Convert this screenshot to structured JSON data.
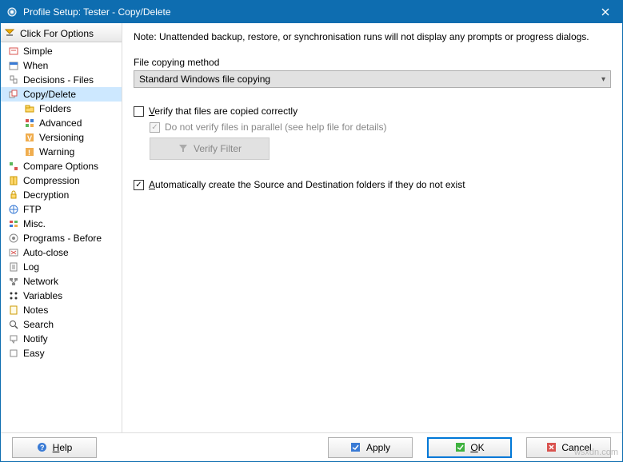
{
  "titlebar": {
    "title": "Profile Setup: Tester - Copy/Delete"
  },
  "sidebar": {
    "options_header": "Click For Options",
    "items": [
      {
        "label": "Simple"
      },
      {
        "label": "When"
      },
      {
        "label": "Decisions - Files"
      },
      {
        "label": "Copy/Delete",
        "selected": true
      },
      {
        "label": "Folders",
        "child": true
      },
      {
        "label": "Advanced",
        "child": true
      },
      {
        "label": "Versioning",
        "child": true
      },
      {
        "label": "Warning",
        "child": true
      },
      {
        "label": "Compare Options"
      },
      {
        "label": "Compression"
      },
      {
        "label": "Decryption"
      },
      {
        "label": "FTP"
      },
      {
        "label": "Misc."
      },
      {
        "label": "Programs - Before"
      },
      {
        "label": "Auto-close"
      },
      {
        "label": "Log"
      },
      {
        "label": "Network"
      },
      {
        "label": "Variables"
      },
      {
        "label": "Notes"
      },
      {
        "label": "Search"
      },
      {
        "label": "Notify"
      },
      {
        "label": "Easy"
      }
    ]
  },
  "main": {
    "note": "Note: Unattended backup, restore, or synchronisation runs will not display any prompts or progress dialogs.",
    "copy_method_label": "File copying method",
    "copy_method_value": "Standard Windows file copying",
    "verify_label": "Verify that files are copied correctly",
    "verify_checked": false,
    "parallel_label": "Do not verify files in parallel (see help file for details)",
    "parallel_checked": true,
    "verify_filter_btn": "Verify Filter",
    "autocreate_label": "Automatically create the Source and Destination folders if they do not exist",
    "autocreate_checked": true
  },
  "footer": {
    "help": "Help",
    "apply": "Apply",
    "ok": "OK",
    "cancel": "Cancel"
  },
  "watermark": "wsxdn.com"
}
